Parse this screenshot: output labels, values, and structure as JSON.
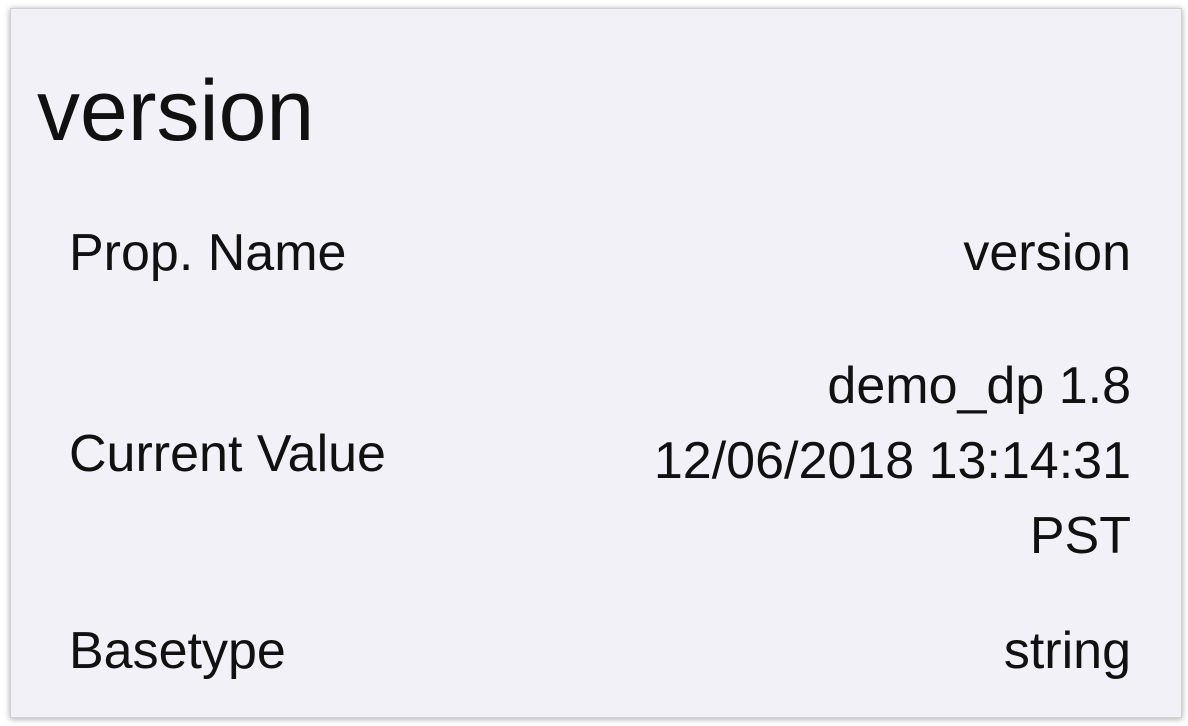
{
  "title": "version",
  "rows": {
    "prop_name": {
      "label": "Prop. Name",
      "value": "version"
    },
    "current_value": {
      "label": "Current Value",
      "value_lines": [
        "demo_dp 1.8",
        "12/06/2018 13:14:31",
        "PST"
      ]
    },
    "basetype": {
      "label": "Basetype",
      "value": "string"
    }
  },
  "colors": {
    "background": "#f1f1f7",
    "text": "#111111"
  }
}
